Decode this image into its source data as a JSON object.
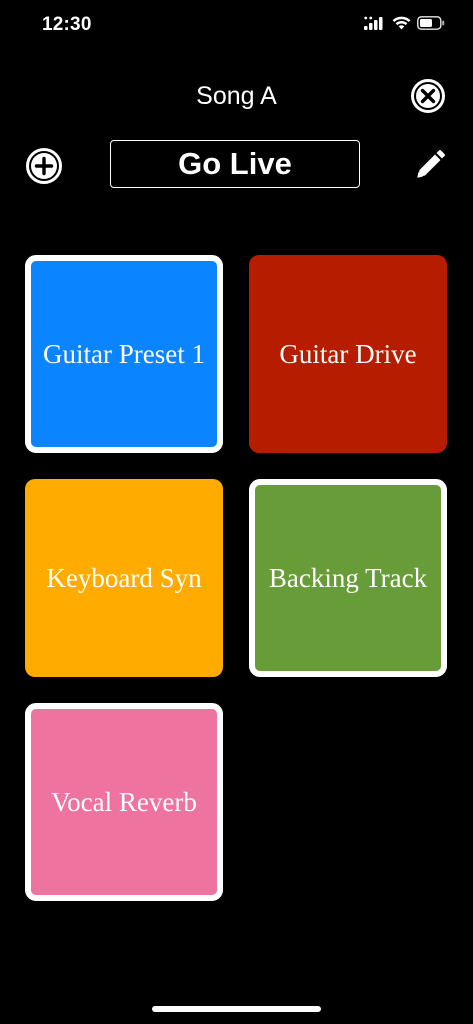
{
  "status_bar": {
    "time": "12:30",
    "icons": [
      "signal-icon",
      "wifi-icon",
      "battery-icon"
    ]
  },
  "header": {
    "title": "Song A",
    "close_icon": "close-circle-icon",
    "add_icon": "plus-circle-icon",
    "edit_icon": "pencil-icon",
    "go_live_label": "Go Live"
  },
  "pads": [
    {
      "label": "Guitar Preset 1",
      "color": "#0A84FF",
      "selected": true
    },
    {
      "label": "Guitar Drive",
      "color": "#B51C00",
      "selected": false
    },
    {
      "label": "Keyboard Syn",
      "color": "#FFAB00",
      "selected": false
    },
    {
      "label": "Backing Track",
      "color": "#679C38",
      "selected": true
    },
    {
      "label": "Vocal Reverb",
      "color": "#EE739F",
      "selected": true
    }
  ],
  "colors": {
    "background": "#000000",
    "foreground": "#FFFFFF"
  }
}
